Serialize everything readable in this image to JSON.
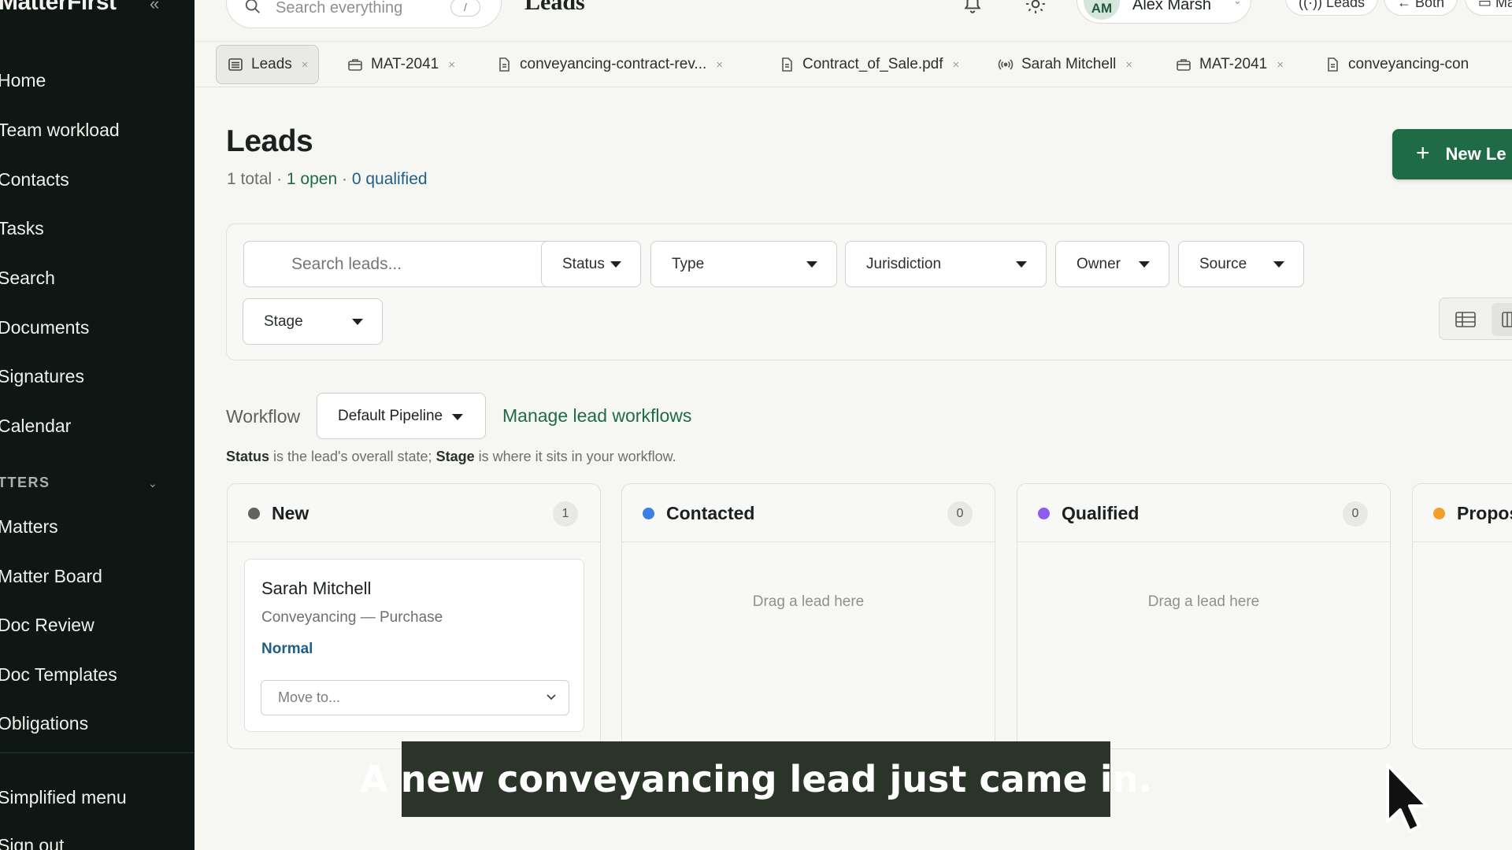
{
  "app": {
    "name": "MatterFirst"
  },
  "sidebar": {
    "items": [
      {
        "label": "Home"
      },
      {
        "label": "Team workload"
      },
      {
        "label": "Contacts"
      },
      {
        "label": "Tasks"
      },
      {
        "label": "Search"
      },
      {
        "label": "Documents"
      },
      {
        "label": "Signatures"
      },
      {
        "label": "Calendar"
      }
    ],
    "section_label": "TTERS",
    "section_items": [
      {
        "label": "Matters"
      },
      {
        "label": "Matter Board"
      },
      {
        "label": "Doc Review"
      },
      {
        "label": "Doc Templates"
      },
      {
        "label": "Obligations"
      }
    ],
    "simplified_menu": "Simplified menu",
    "sign_out": "Sign out"
  },
  "topbar": {
    "search_placeholder": "Search everything",
    "search_shortcut": "/",
    "page_title": "Leads",
    "user_initials": "AM",
    "user_name": "Alex Marsh",
    "chips": [
      {
        "label": "Leads"
      },
      {
        "label": "Both"
      },
      {
        "label": "Ma"
      }
    ]
  },
  "tabs": [
    {
      "label": "Leads",
      "icon": "list-icon",
      "active": true
    },
    {
      "label": "MAT-2041",
      "icon": "briefcase-icon"
    },
    {
      "label": "conveyancing-contract-rev...",
      "icon": "document-icon"
    },
    {
      "label": "Contract_of_Sale.pdf",
      "icon": "document-icon"
    },
    {
      "label": "Sarah Mitchell",
      "icon": "broadcast-icon"
    },
    {
      "label": "MAT-2041",
      "icon": "briefcase-icon"
    },
    {
      "label": "conveyancing-con",
      "icon": "document-icon"
    }
  ],
  "page": {
    "title": "Leads",
    "total": "1 total",
    "open": "1 open",
    "qualified": "0 qualified",
    "separator": "·",
    "new_button": "New Le"
  },
  "filters": {
    "search_placeholder": "Search leads...",
    "status": "Status",
    "type": "Type",
    "jurisdiction": "Jurisdiction",
    "owner": "Owner",
    "source": "Source",
    "stage": "Stage"
  },
  "workflow": {
    "label": "Workflow",
    "selected": "Default Pipeline",
    "manage_link": "Manage lead workflows",
    "help_status": "Status",
    "help_mid": " is the lead's overall state; ",
    "help_stage": "Stage",
    "help_end": " is where it sits in your workflow."
  },
  "board": {
    "columns": [
      {
        "title": "New",
        "count": "1",
        "color": "#5f6461"
      },
      {
        "title": "Contacted",
        "count": "0",
        "color": "#3d7fe0",
        "empty": "Drag a lead here"
      },
      {
        "title": "Qualified",
        "count": "0",
        "color": "#8b5cf0",
        "empty": "Drag a lead here"
      },
      {
        "title": "Propos",
        "color": "#f0a02a"
      }
    ],
    "card": {
      "name": "Sarah Mitchell",
      "type": "Conveyancing — Purchase",
      "priority": "Normal",
      "move_placeholder": "Move to..."
    }
  },
  "caption": "A new conveyancing lead just came in."
}
